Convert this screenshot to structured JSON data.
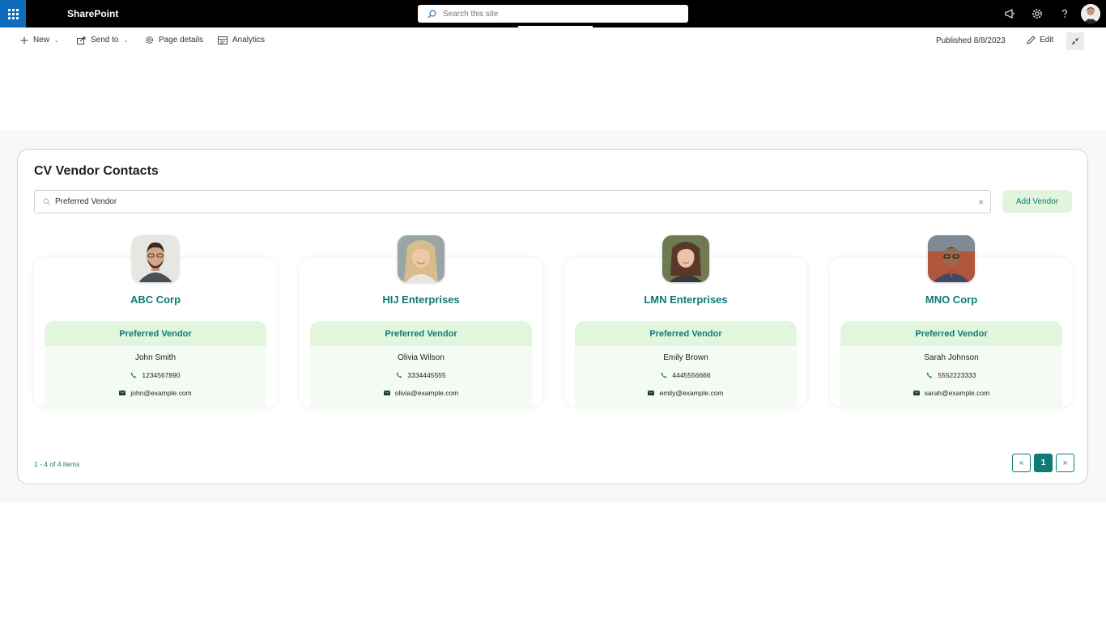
{
  "suite": {
    "brand": "SharePoint",
    "search_placeholder": "Search this site"
  },
  "commands": {
    "new": "New",
    "send_to": "Send to",
    "page_details": "Page details",
    "analytics": "Analytics",
    "published": "Published 8/8/2023",
    "edit": "Edit"
  },
  "panel": {
    "title": "CV Vendor Contacts",
    "filter_value": "Preferred Vendor",
    "add_button": "Add Vendor",
    "count": "1 - 4 of 4 items",
    "pager": {
      "prev": "«",
      "page": "1",
      "next": "»"
    }
  },
  "vendors": [
    {
      "company": "ABC Corp",
      "category": "Preferred Vendor",
      "contact": "John Smith",
      "phone": "1234567890",
      "email": "john@example.com"
    },
    {
      "company": "HIJ Enterprises",
      "category": "Preferred Vendor",
      "contact": "Olivia Wilson",
      "phone": "3334445555",
      "email": "olivia@example.com"
    },
    {
      "company": "LMN Enterprises",
      "category": "Preferred Vendor",
      "contact": "Emily Brown",
      "phone": "4445556666",
      "email": "emily@example.com"
    },
    {
      "company": "MNO Corp",
      "category": "Preferred Vendor",
      "contact": "Sarah Johnson",
      "phone": "5552223333",
      "email": "sarah@example.com"
    }
  ],
  "colors": {
    "accent": "#0f7a76",
    "waffle": "#0f6cbd",
    "preferred_bg": "#e2f6dd"
  }
}
